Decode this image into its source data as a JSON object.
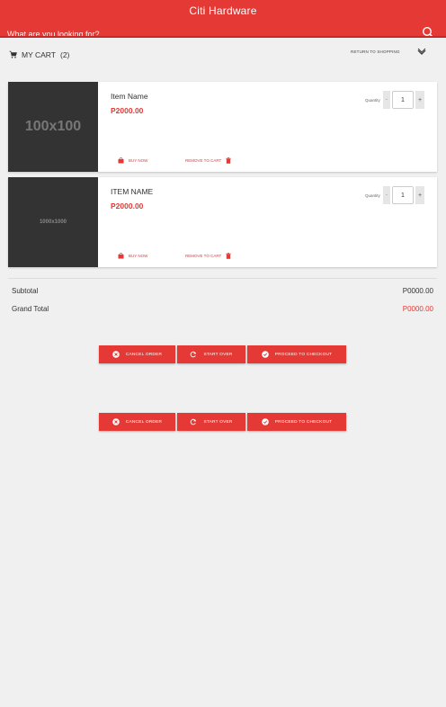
{
  "header": {
    "title": "Citi Hardware",
    "search_placeholder": "What are you looking for?",
    "search_icon": "search-icon"
  },
  "cart_bar": {
    "label": "MY CART",
    "count": "(2)",
    "icon": "cart-icon",
    "return_label": "RETURN TO SHOPPING",
    "return_icon": "chevron-down-icon"
  },
  "items": [
    {
      "image_text": "100x100",
      "name": "Item Name",
      "price": "P2000.00",
      "quantity_label": "Quantity",
      "quantity": "1",
      "minus": "-",
      "plus": "+",
      "buy_label": "BUY NOW",
      "remove_label": "REMOVE TO CART"
    },
    {
      "image_text": "1000x1000",
      "name": "ITEM NAME",
      "price": "P2000.00",
      "quantity_label": "Quantity",
      "quantity": "1",
      "minus": "-",
      "plus": "+",
      "buy_label": "BUY NOW",
      "remove_label": "REMOVE TO CART"
    }
  ],
  "totals": {
    "subtotal_label": "Subtotal",
    "subtotal_value": "P0000.00",
    "grand_total_label": "Grand Total",
    "grand_total_value": "P0000.00"
  },
  "actions": {
    "cancel_label": "CANCEL ORDER",
    "start_over_label": "START OVER",
    "checkout_label": "PROCEED TO CHECKOUT"
  },
  "colors": {
    "accent": "#e53935",
    "header_border": "#c62828",
    "background": "#f0f0f0",
    "thumbnail": "#333333"
  }
}
